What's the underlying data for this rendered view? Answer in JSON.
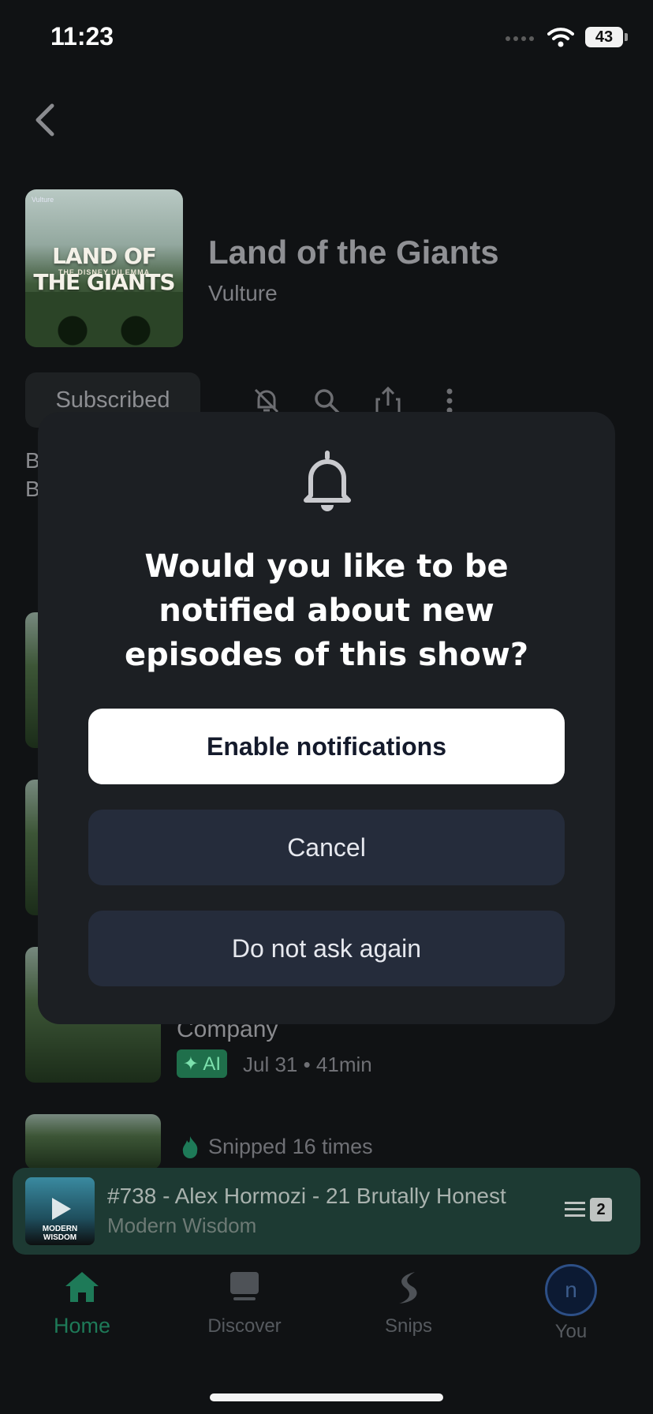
{
  "status_bar": {
    "time": "11:23",
    "battery": "43"
  },
  "show": {
    "artwork": {
      "brand": "Vulture",
      "title_art": "LAND OF THE GIANTS",
      "subtitle_art": "THE DISNEY DILEMMA"
    },
    "title": "Land of the Giants",
    "author": "Vulture",
    "subscribe_label": "Subscribed"
  },
  "episodes_background": {
    "partial_desc_1": "B",
    "partial_desc_2": "B",
    "episode_title_fragment": "Company",
    "ai_badge": "✦ AI",
    "episode_meta": "Jul 31 • 41min",
    "snipped_text": "Snipped 16 times"
  },
  "dialog": {
    "question": "Would you like to be notified about new episodes of this show?",
    "enable_label": "Enable notifications",
    "cancel_label": "Cancel",
    "dont_ask_label": "Do not ask again"
  },
  "player": {
    "art_label": "MODERN WISDOM",
    "title": "#738 - Alex Hormozi - 21 Brutally Honest",
    "subtitle": "Modern Wisdom",
    "queue_count": "2"
  },
  "tabs": [
    {
      "label": "Home",
      "icon": "home-icon",
      "active": true
    },
    {
      "label": "Discover",
      "icon": "discover-icon",
      "active": false
    },
    {
      "label": "Snips",
      "icon": "snips-icon",
      "active": false
    },
    {
      "label": "You",
      "icon": "avatar",
      "active": false
    }
  ],
  "avatar_initial": "n",
  "colors": {
    "accent_green": "#1e7a58",
    "modal_bg": "#1c1f23",
    "secondary_button": "#252c3b"
  }
}
